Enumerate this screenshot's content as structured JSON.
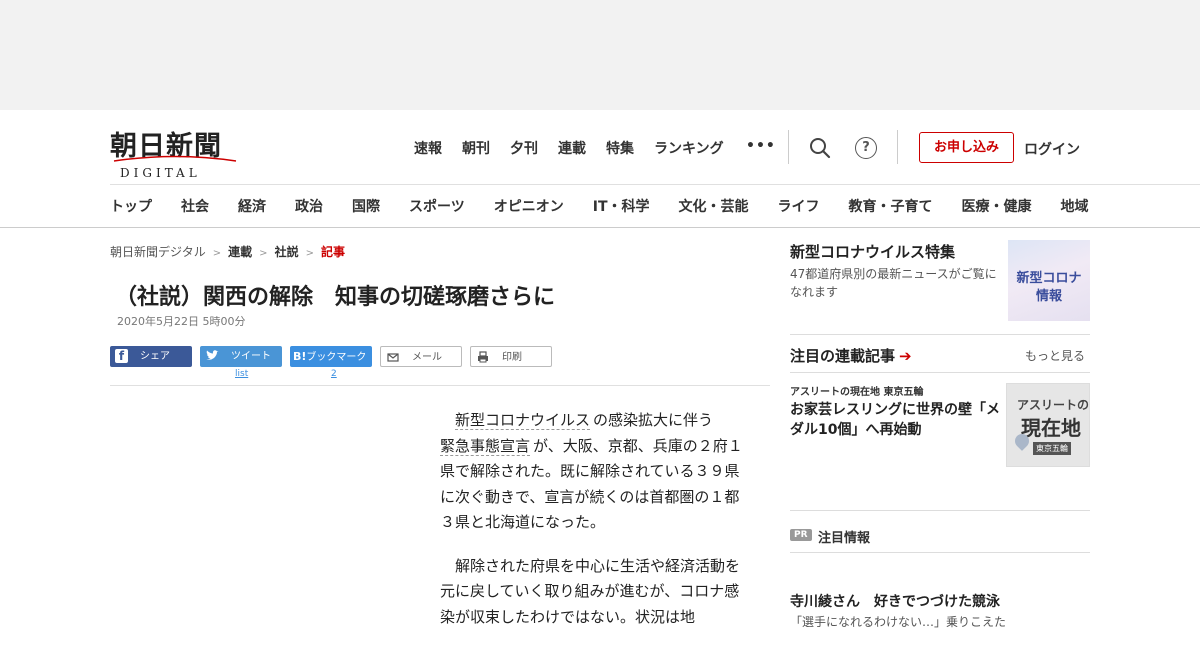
{
  "header": {
    "logo_jp": "朝日新聞",
    "logo_en": "DIGITAL",
    "nav": [
      "速報",
      "朝刊",
      "夕刊",
      "連載",
      "特集",
      "ランキング"
    ],
    "more": "•••",
    "help": "?",
    "subscribe": "お申し込み",
    "login": "ログイン"
  },
  "categories": [
    "トップ",
    "社会",
    "経済",
    "政治",
    "国際",
    "スポーツ",
    "オピニオン",
    "IT・科学",
    "文化・芸能",
    "ライフ",
    "教育・子育て",
    "医療・健康",
    "地域"
  ],
  "breadcrumb": {
    "items": [
      "朝日新聞デジタル",
      "連載",
      "社説"
    ],
    "current": "記事",
    "sep": ">"
  },
  "article": {
    "title": "（社説）関西の解除　知事の切磋琢磨さらに",
    "date": "2020年5月22日 5時00分",
    "para1_kw1": "新型コロナウイルス",
    "para1_a": "の感染拡大に伴う",
    "para1_kw2": "緊急事態宣言",
    "para1_b": "が、大阪、京都、兵庫の２府１県で解除された。既に解除されている３９県に次ぐ動きで、宣言が続くのは首都圏の１都３県と北海道になった。",
    "para2": "解除された府県を中心に生活や経済活動を元に戻していく取り組みが進むが、コロナ感染が収束したわけではない。状況は地"
  },
  "share": {
    "facebook": "シェア",
    "twitter": "ツイート",
    "twitter_count": "list",
    "hatena_logo": "B!",
    "hatena": "ブックマーク",
    "hatena_count": "2",
    "mail": "メール",
    "print": "印刷"
  },
  "sidebar": {
    "covid_title": "新型コロナウイルス特集",
    "covid_desc": "47都道府県別の最新ニュースがご覧になれます",
    "covid_thumb_1": "新型コロナ",
    "covid_thumb_2": "情報",
    "rensai_title": "注目の連載記事",
    "rensai_arrow": "➔",
    "more": "もっと見る",
    "athlete_tag": "アスリートの現在地 東京五輪",
    "athlete_headline": "お家芸レスリングに世界の壁「メダル10個」へ再始動",
    "athlete_thumb_1": "アスリートの",
    "athlete_thumb_2": "現在地",
    "athlete_thumb_3": "東京五輪",
    "pr_badge": "PR",
    "pr_label": "注目情報",
    "pr_headline": "寺川綾さん　好きでつづけた競泳",
    "pr_sub": "「選手になれるわけない…」乗りこえた"
  },
  "colors": {
    "accent": "#cc0000",
    "facebook": "#3b5998",
    "twitter": "#4a95d6",
    "hatena": "#3b8fe0"
  }
}
